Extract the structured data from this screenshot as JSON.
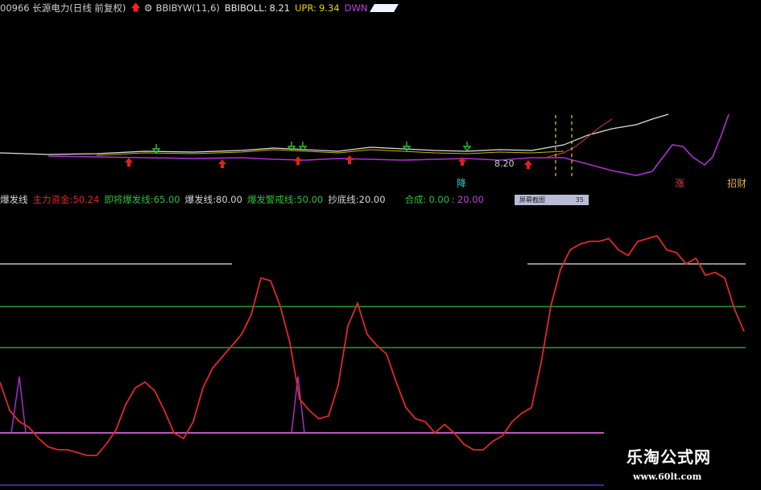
{
  "header": {
    "code_name": "00966 长源电力(日线 前复权)",
    "indicator_icon": "circle-gear-icon",
    "indicator": "BBIBYW(11,6)",
    "bbiboll_label": "BBIBOLL:",
    "bbiboll_value": "8.21",
    "upr_label": "UPR:",
    "upr_value": "9.34",
    "dwn_label": "DWN",
    "arrow_icon": "red-up-arrow-icon"
  },
  "sub_header": {
    "title": "爆发线",
    "items": [
      {
        "label": "主力资金:",
        "value": "50.24",
        "color": "#e02828"
      },
      {
        "label": "即将爆发线:",
        "value": "65.00",
        "color": "#2fbf3a"
      },
      {
        "label": "爆发线:",
        "value": "80.00",
        "color": "#d8d8d8"
      },
      {
        "label": "爆发警戒线:",
        "value": "50.00",
        "color": "#2fbf3a"
      },
      {
        "label": "抄底线:",
        "value": "20.00",
        "color": "#d8d8d8"
      }
    ],
    "hecheng_label": "合成:",
    "hecheng_v1": "0.00",
    "hecheng_v2": "20.00",
    "button_label": "屏幕截图",
    "button_value": "35"
  },
  "annotations": {
    "price_low": "8.20",
    "jiang_label": "降",
    "zhang_label": "涨",
    "zhaocai_label": "招财"
  },
  "watermark": {
    "line1": "乐淘公式网",
    "line2": "www.60lt.com"
  },
  "colors": {
    "main_fund": "#e02828",
    "bbi": "#e8e8e8",
    "lower": "#b030d0",
    "green": "#2fbf3a",
    "magenta": "#ff70ff"
  },
  "chart_data": {
    "type": "line",
    "reference_lines": [
      {
        "name": "爆发线",
        "value": 80
      },
      {
        "name": "即将爆发线",
        "value": 65
      },
      {
        "name": "爆发警戒线",
        "value": 50
      },
      {
        "name": "抄底线",
        "value": 20
      }
    ],
    "ylim": [
      10,
      100
    ],
    "series": [
      {
        "name": "主力资金",
        "x": [
          0,
          12,
          24,
          36,
          48,
          60,
          72,
          84,
          96,
          108,
          120,
          132,
          144,
          156,
          168,
          180,
          192,
          204,
          216,
          228,
          240,
          252,
          264,
          276,
          288,
          300,
          312,
          324,
          336,
          348,
          360,
          372,
          384,
          396,
          408,
          420,
          432,
          444,
          456,
          468,
          480,
          492,
          504,
          516,
          528,
          540,
          552,
          564,
          576,
          588,
          600,
          612,
          624,
          636,
          648,
          660,
          672,
          684,
          696,
          708,
          720,
          732,
          744,
          756,
          768,
          780,
          792,
          804,
          816,
          828,
          840,
          852,
          864,
          876,
          888,
          900,
          912,
          924
        ],
        "values": [
          38,
          28,
          24,
          22,
          18,
          15,
          14,
          14,
          13,
          12,
          12,
          16,
          21,
          30,
          36,
          38,
          35,
          28,
          20,
          18,
          24,
          36,
          43,
          47,
          51,
          55,
          62,
          75,
          74,
          65,
          52,
          32,
          28,
          25,
          26,
          37,
          58,
          66,
          55,
          51,
          48,
          38,
          29,
          25,
          24,
          20,
          23,
          20,
          16,
          14,
          14,
          17,
          19,
          24,
          27,
          29,
          45,
          65,
          78,
          85,
          87,
          88,
          88,
          89,
          85,
          83,
          88,
          89,
          90,
          85,
          84,
          80,
          82,
          76,
          77,
          75,
          64,
          56
        ]
      }
    ]
  }
}
